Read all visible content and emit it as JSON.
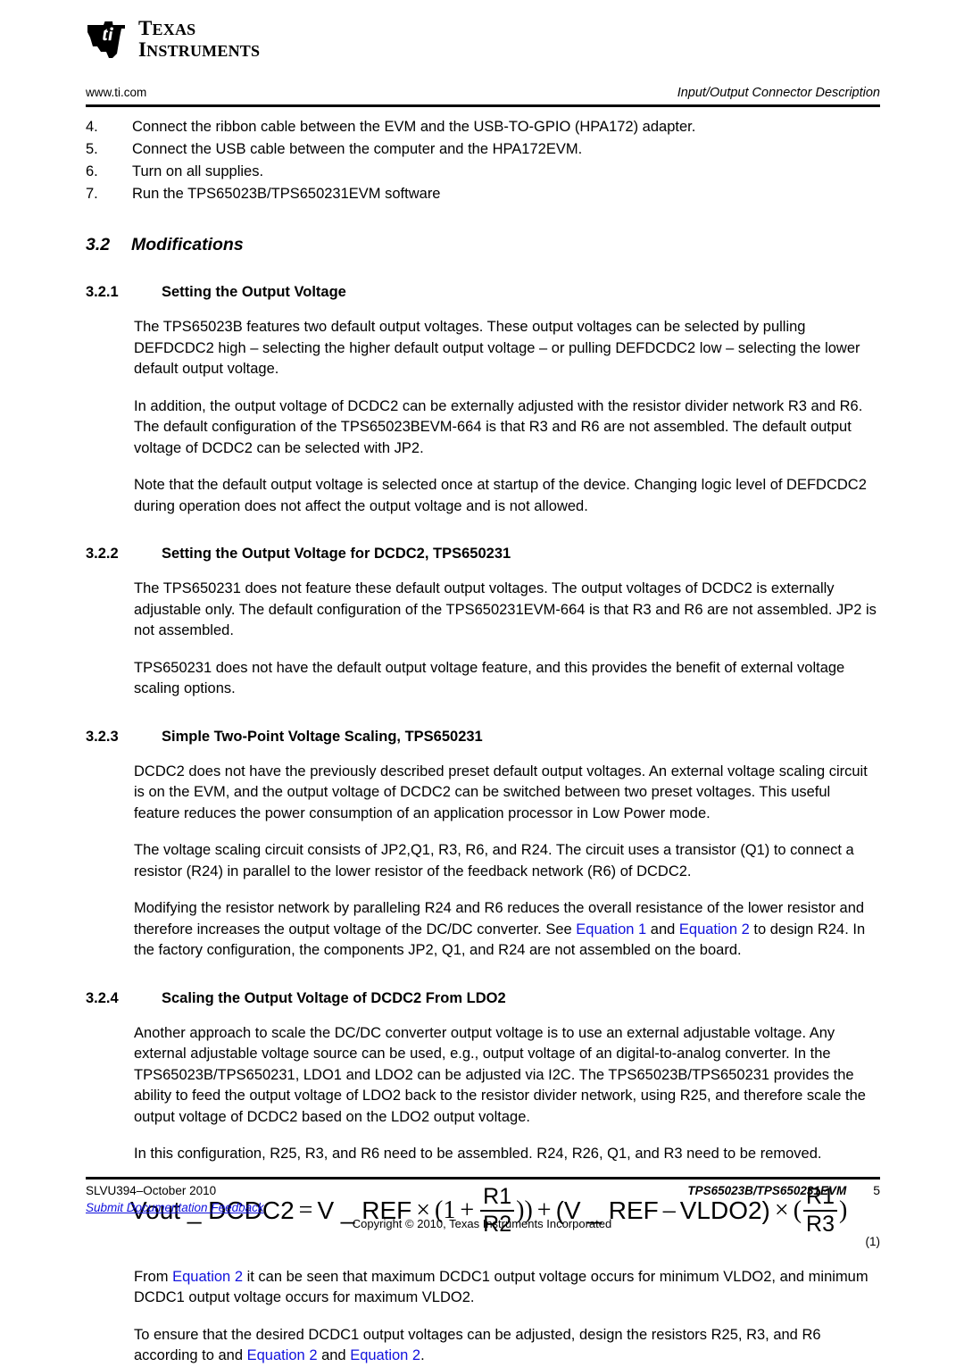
{
  "header": {
    "logo_line1": "TEXAS",
    "logo_line2": "INSTRUMENTS",
    "url": "www.ti.com",
    "section_title": "Input/Output Connector Description"
  },
  "steps": [
    {
      "num": "4.",
      "text": "Connect the ribbon cable between the EVM and the USB-TO-GPIO (HPA172) adapter."
    },
    {
      "num": "5.",
      "text": "Connect the USB cable between the computer and the HPA172EVM."
    },
    {
      "num": "6.",
      "text": "Turn on all supplies."
    },
    {
      "num": "7.",
      "text": "Run the TPS65023B/TPS650231EVM software"
    }
  ],
  "section": {
    "number": "3.2",
    "title": "Modifications"
  },
  "sub_3_2_1": {
    "number": "3.2.1",
    "title": "Setting the Output Voltage",
    "p1": "The TPS65023B features two default output voltages. These output voltages can be selected by pulling DEFDCDC2 high – selecting the higher default output voltage – or pulling DEFDCDC2 low – selecting the lower default output voltage.",
    "p2": "In addition, the output voltage of DCDC2 can be externally adjusted with the resistor divider network R3 and R6. The default configuration of the TPS65023BEVM-664 is that R3 and R6 are not assembled. The default output voltage of DCDC2 can be selected with JP2.",
    "p3": "Note that the default output voltage is selected once at startup of the device. Changing logic level of DEFDCDC2 during operation does not affect the output voltage and is not allowed."
  },
  "sub_3_2_2": {
    "number": "3.2.2",
    "title": "Setting the Output Voltage for DCDC2, TPS650231",
    "p1": "The TPS650231 does not feature these default output voltages. The output voltages of DCDC2 is externally adjustable only. The default configuration of the TPS650231EVM-664 is that R3 and R6 are not assembled. JP2 is not assembled.",
    "p2": "TPS650231 does not have the default output voltage feature, and this provides the benefit of external voltage scaling options."
  },
  "sub_3_2_3": {
    "number": "3.2.3",
    "title": "Simple Two-Point Voltage Scaling, TPS650231",
    "p1": "DCDC2 does not have the previously described preset default output voltages. An external voltage scaling circuit is on the EVM, and the output voltage of DCDC2 can be switched between two preset voltages. This useful feature reduces the power consumption of an application processor in Low Power mode.",
    "p2": "The voltage scaling circuit consists of JP2,Q1, R3, R6, and R24. The circuit uses a transistor (Q1) to connect a resistor (R24) in parallel to the lower resistor of the feedback network (R6) of DCDC2.",
    "p3_a": "Modifying the resistor network by paralleling R24 and R6 reduces the overall resistance of the lower resistor and therefore increases the output voltage of the DC/DC converter. See ",
    "p3_link1": "Equation 1",
    "p3_b": " and ",
    "p3_link2": "Equation 2",
    "p3_c": " to design R24. In the factory configuration, the components JP2, Q1, and R24 are not assembled on the board."
  },
  "sub_3_2_4": {
    "number": "3.2.4",
    "title": "Scaling the Output Voltage of DCDC2 From LDO2",
    "p1": "Another approach to scale the DC/DC converter output voltage is to use an external adjustable voltage. Any external adjustable voltage source can be used, e.g., output voltage of an digital-to-analog converter. In the TPS65023B/TPS650231, LDO1 and LDO2 can be adjusted via I2C. The TPS65023B/TPS650231 provides the ability to feed the output voltage of LDO2 back to the resistor divider network, using R25, and therefore scale the output voltage of DCDC2 based on the LDO2 output voltage.",
    "p2": "In this configuration, R25, R3, and R6 need to be assembled. R24, R26, Q1, and R3 need to be removed.",
    "p3_a": "From ",
    "p3_link1": "Equation 2",
    "p3_b": " it can be seen that maximum DCDC1 output voltage occurs for minimum VLDO2, and minimum DCDC1 output voltage occurs for maximum VLDO2.",
    "p4_a": "To ensure that the desired DCDC1 output voltages can be adjusted, design the resistors R25, R3, and R6 according to and ",
    "p4_link1": "Equation 2",
    "p4_b": " and ",
    "p4_link2": "Equation 2",
    "p4_c": "."
  },
  "equation": {
    "lhs": "Vout _ DCDC2",
    "eq": "=",
    "t1": "V _ REF",
    "times1": "×",
    "open1": "(1",
    "plus1": "+",
    "frac1_num": "R1",
    "frac1_den": "R2",
    "close1": "))",
    "plus2": "+",
    "open2": "(V _ REF",
    "minus": "–",
    "t2": "VLDO2)",
    "times2": "×",
    "open3": "(",
    "frac2_num": "R1",
    "frac2_den": "R3",
    "close3": ")",
    "number": "(1)"
  },
  "footer": {
    "doc_id": "SLVU394–October 2010",
    "feedback": "Submit Documentation Feedback",
    "device": "TPS65023B/TPS650231EVM",
    "page": "5",
    "copyright": "Copyright © 2010, Texas Instruments Incorporated"
  },
  "colors": {
    "link": "#1111dd",
    "rule": "#000000"
  }
}
